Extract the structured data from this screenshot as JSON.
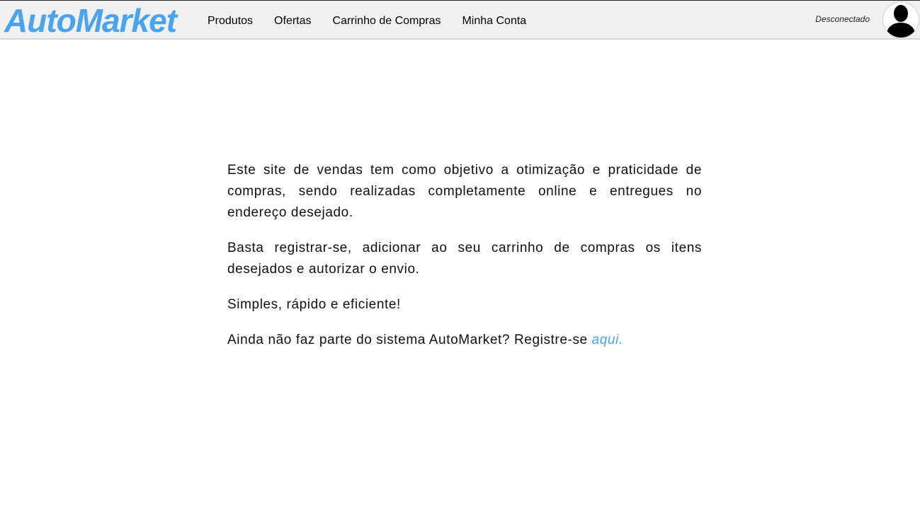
{
  "header": {
    "logo": "AutoMarket",
    "nav": [
      {
        "label": "Produtos"
      },
      {
        "label": "Ofertas"
      },
      {
        "label": "Carrinho de Compras"
      },
      {
        "label": "Minha Conta"
      }
    ],
    "status": "Desconectado",
    "avatar_icon": "user-silhouette-icon"
  },
  "main": {
    "paragraph1": "Este site de vendas tem como objetivo a otimização e praticidade de compras, sendo realizadas completamente online e entregues no endereço desejado.",
    "paragraph2": "Basta registrar-se, adicionar ao seu carrinho de compras os itens desejados e autorizar o envio.",
    "paragraph3": "Simples, rápido e eficiente!",
    "paragraph4_prefix": "Ainda não faz parte do sistema AutoMarket? Registre-se ",
    "register_link": "aqui."
  },
  "colors": {
    "brand": "#4aa3ef",
    "header_bg": "#f1f1f1"
  }
}
